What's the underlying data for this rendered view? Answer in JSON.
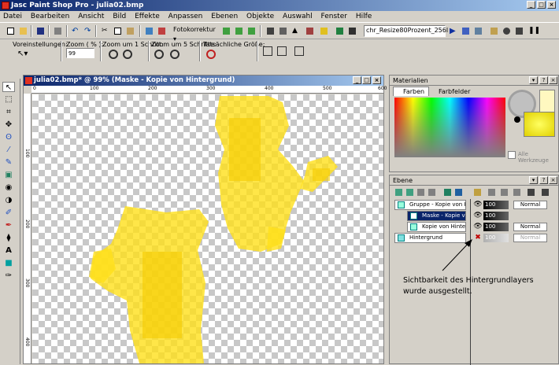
{
  "app": {
    "title": "Jasc Paint Shop Pro - julia02.bmp"
  },
  "menu": [
    "Datei",
    "Bearbeiten",
    "Ansicht",
    "Bild",
    "Effekte",
    "Anpassen",
    "Ebenen",
    "Objekte",
    "Auswahl",
    "Fenster",
    "Hilfe"
  ],
  "toolbar": {
    "fotokorrektur": "Fotokorrektur",
    "script_name": "chr_Resize80Prozent_256l"
  },
  "options": {
    "voreinstellungen": "Voreinstellungen:",
    "zoom_label": "Zoom ( % ):",
    "zoom_value": "99",
    "zoom_step1": "Zoom um 1 Schritt:",
    "zoom_step5": "Zoom um 5 Schritte:",
    "actual_size": "Tatsächliche Größe:"
  },
  "document": {
    "title": "julia02.bmp* @ 99% (Maske - Kopie von Hintergrund)",
    "ruler_h": [
      "0",
      "100",
      "200",
      "300",
      "400",
      "500",
      "600"
    ],
    "ruler_v": [
      "100",
      "200",
      "300",
      "400"
    ]
  },
  "materials": {
    "title": "Materialien",
    "tab_colors": "Farben",
    "tab_swatches": "Farbfelder",
    "all_tools": "Alle Werkzeuge"
  },
  "layers": {
    "title": "Ebene",
    "items": [
      {
        "name": "Gruppe - Kopie von Hinte",
        "opacity": "100",
        "blend": "Normal",
        "selected": false
      },
      {
        "name": "Maske - Kopie von Hin",
        "opacity": "100",
        "blend": "",
        "selected": true
      },
      {
        "name": "Kopie von Hintergrund",
        "opacity": "100",
        "blend": "Normal",
        "selected": false
      },
      {
        "name": "Hintergrund",
        "opacity": "100",
        "blend": "Normal",
        "selected": false
      }
    ]
  },
  "annotation": {
    "line1": "Sichtbarkeit des Hintergrundlayers",
    "line2": "wurde ausgestellt."
  },
  "colors": {
    "title_blue": "#0a246a",
    "shape_yellow": "#ffe01a",
    "selection": "#0a246a"
  }
}
